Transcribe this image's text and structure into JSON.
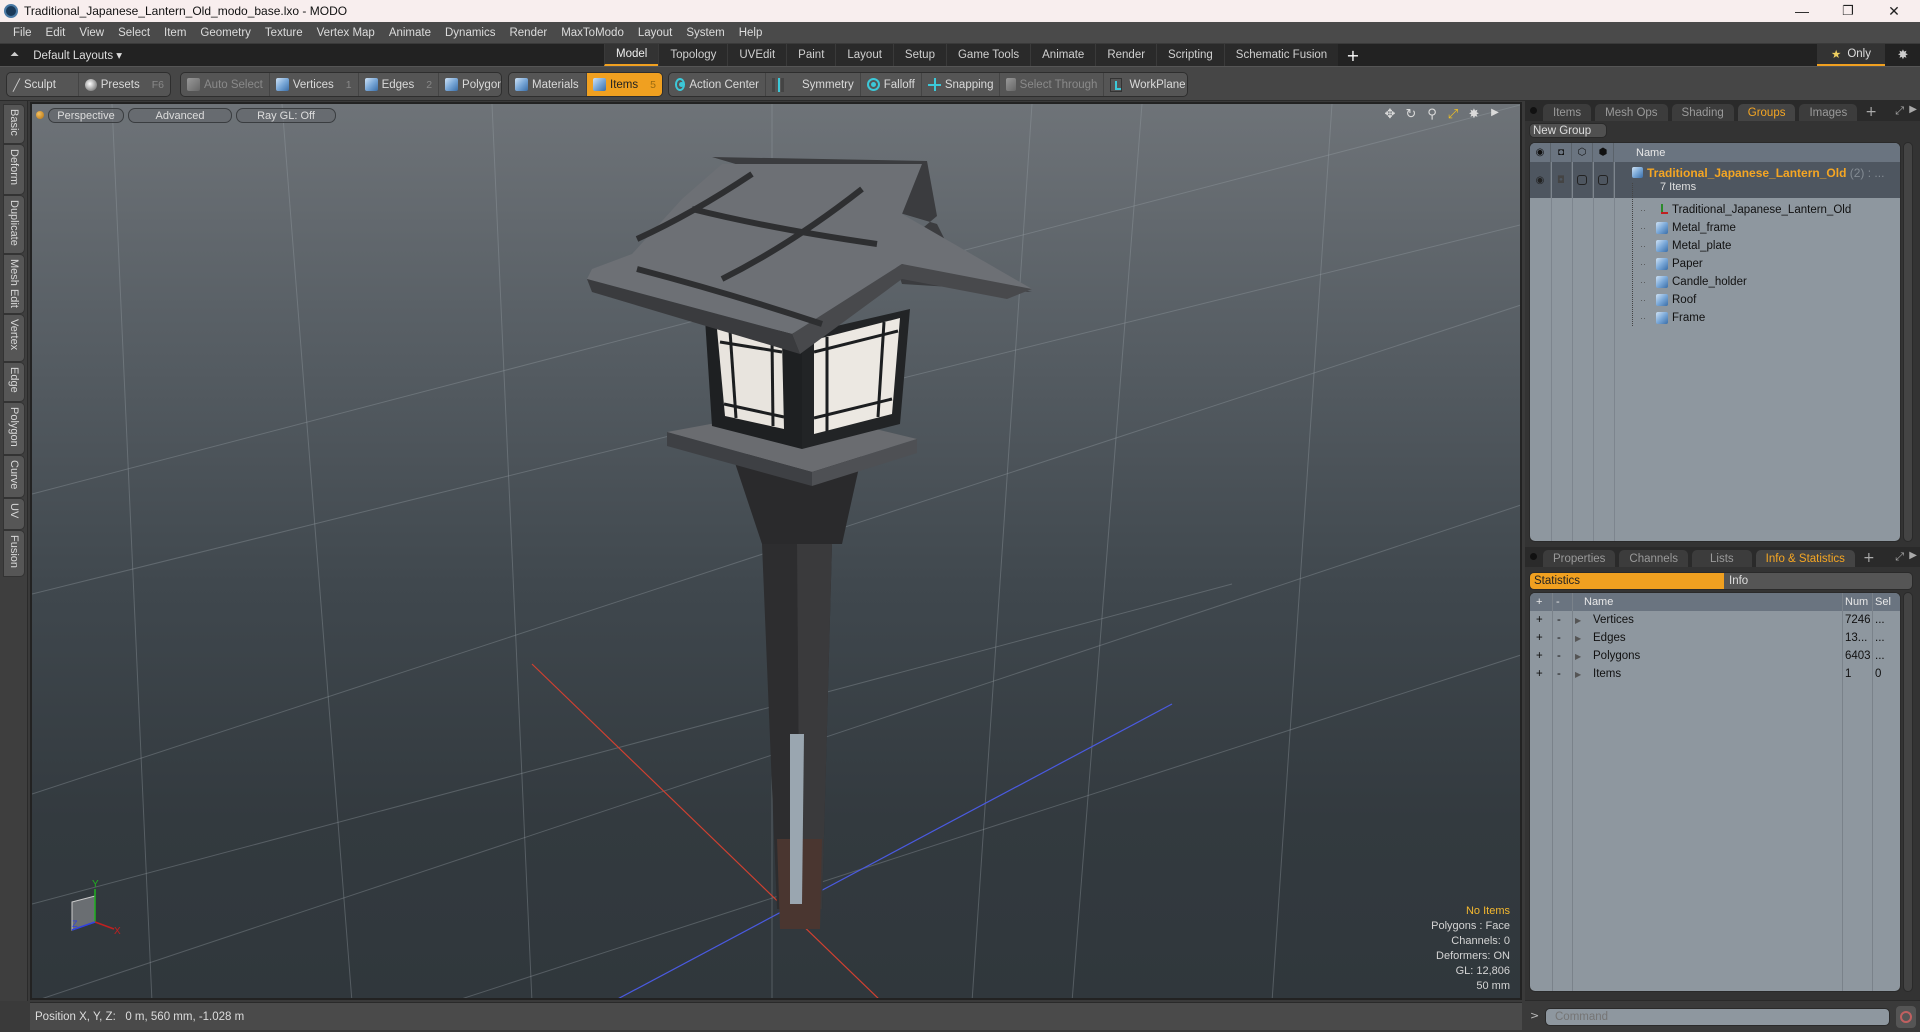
{
  "window": {
    "title": "Traditional_Japanese_Lantern_Old_modo_base.lxo - MODO",
    "minimize": "—",
    "maximize": "❐",
    "close": "✕"
  },
  "menu": [
    "File",
    "Edit",
    "View",
    "Select",
    "Item",
    "Geometry",
    "Texture",
    "Vertex Map",
    "Animate",
    "Dynamics",
    "Render",
    "MaxToModo",
    "Layout",
    "System",
    "Help"
  ],
  "layoutbar": {
    "layouts_label": "Default Layouts ▾",
    "tabs": [
      "Model",
      "Topology",
      "UVEdit",
      "Paint",
      "Layout",
      "Setup",
      "Game Tools",
      "Animate",
      "Render",
      "Scripting",
      "Schematic Fusion"
    ],
    "active_tab": "Model",
    "add_tab": "+",
    "only_label": "Only",
    "star": "★",
    "gear": "✸"
  },
  "toolbar": {
    "sculpt": "Sculpt",
    "presets": "Presets",
    "presets_key": "F6",
    "auto_select": "Auto Select",
    "vertices": "Vertices",
    "vertices_key": "1",
    "edges": "Edges",
    "edges_key": "2",
    "polygons": "Polygons",
    "materials": "Materials",
    "items": "Items",
    "items_key": "5",
    "action_center": "Action Center",
    "symmetry": "Symmetry",
    "falloff": "Falloff",
    "snapping": "Snapping",
    "select_through": "Select Through",
    "workplane": "WorkPlane"
  },
  "left_tabs": [
    "Basic",
    "Deform",
    "Duplicate",
    "Mesh Edit",
    "Vertex",
    "Edge",
    "Polygon",
    "Curve",
    "UV",
    "Fusion"
  ],
  "viewport": {
    "view_mode": "Perspective",
    "shading": "Advanced",
    "raygl": "Ray GL: Off",
    "info": {
      "selection": "No Items",
      "polygons": "Polygons : Face",
      "channels": "Channels: 0",
      "deformers": "Deformers: ON",
      "gl": "GL: 12,806",
      "focal": "50 mm"
    },
    "axis_labels": {
      "x": "X",
      "y": "Y",
      "z": "Z"
    }
  },
  "statusbar": {
    "position": "Position X, Y, Z:   0 m, 560 mm, -1.028 m"
  },
  "groups_panel": {
    "tabs": [
      "Items",
      "Mesh Ops",
      "Shading",
      "Groups",
      "Images"
    ],
    "active_tab": "Groups",
    "new_group": "New Group",
    "column_name": "Name",
    "group": {
      "name": "Traditional_Japanese_Lantern_Old",
      "count_suffix": "(2) :  ...",
      "sub": "7 Items"
    },
    "items": [
      {
        "name": "Traditional_Japanese_Lantern_Old",
        "icon": "locator-axis-icon"
      },
      {
        "name": "Metal_frame",
        "icon": "mesh-cube-icon"
      },
      {
        "name": "Metal_plate",
        "icon": "mesh-cube-icon"
      },
      {
        "name": "Paper",
        "icon": "mesh-cube-icon"
      },
      {
        "name": "Candle_holder",
        "icon": "mesh-cube-icon"
      },
      {
        "name": "Roof",
        "icon": "mesh-cube-icon"
      },
      {
        "name": "Frame",
        "icon": "mesh-cube-icon"
      }
    ]
  },
  "info_panel": {
    "tabs": [
      "Properties",
      "Channels",
      "Lists",
      "Info & Statistics"
    ],
    "active_tab": "Info & Statistics",
    "subtabs": {
      "statistics": "Statistics",
      "info": "Info"
    },
    "columns": {
      "plus": "+",
      "minus": "-",
      "name": "Name",
      "num": "Num",
      "sel": "Sel"
    },
    "rows": [
      {
        "name": "Vertices",
        "num": "7246",
        "sel": "..."
      },
      {
        "name": "Edges",
        "num": "13...",
        "sel": "..."
      },
      {
        "name": "Polygons",
        "num": "6403",
        "sel": "..."
      },
      {
        "name": "Items",
        "num": "1",
        "sel": "0"
      }
    ]
  },
  "command": {
    "prompt": ">",
    "placeholder": "Command"
  },
  "colors": {
    "accent": "#f0a020",
    "group_name": "#f5a623",
    "info_highlight": "#f5b830"
  }
}
